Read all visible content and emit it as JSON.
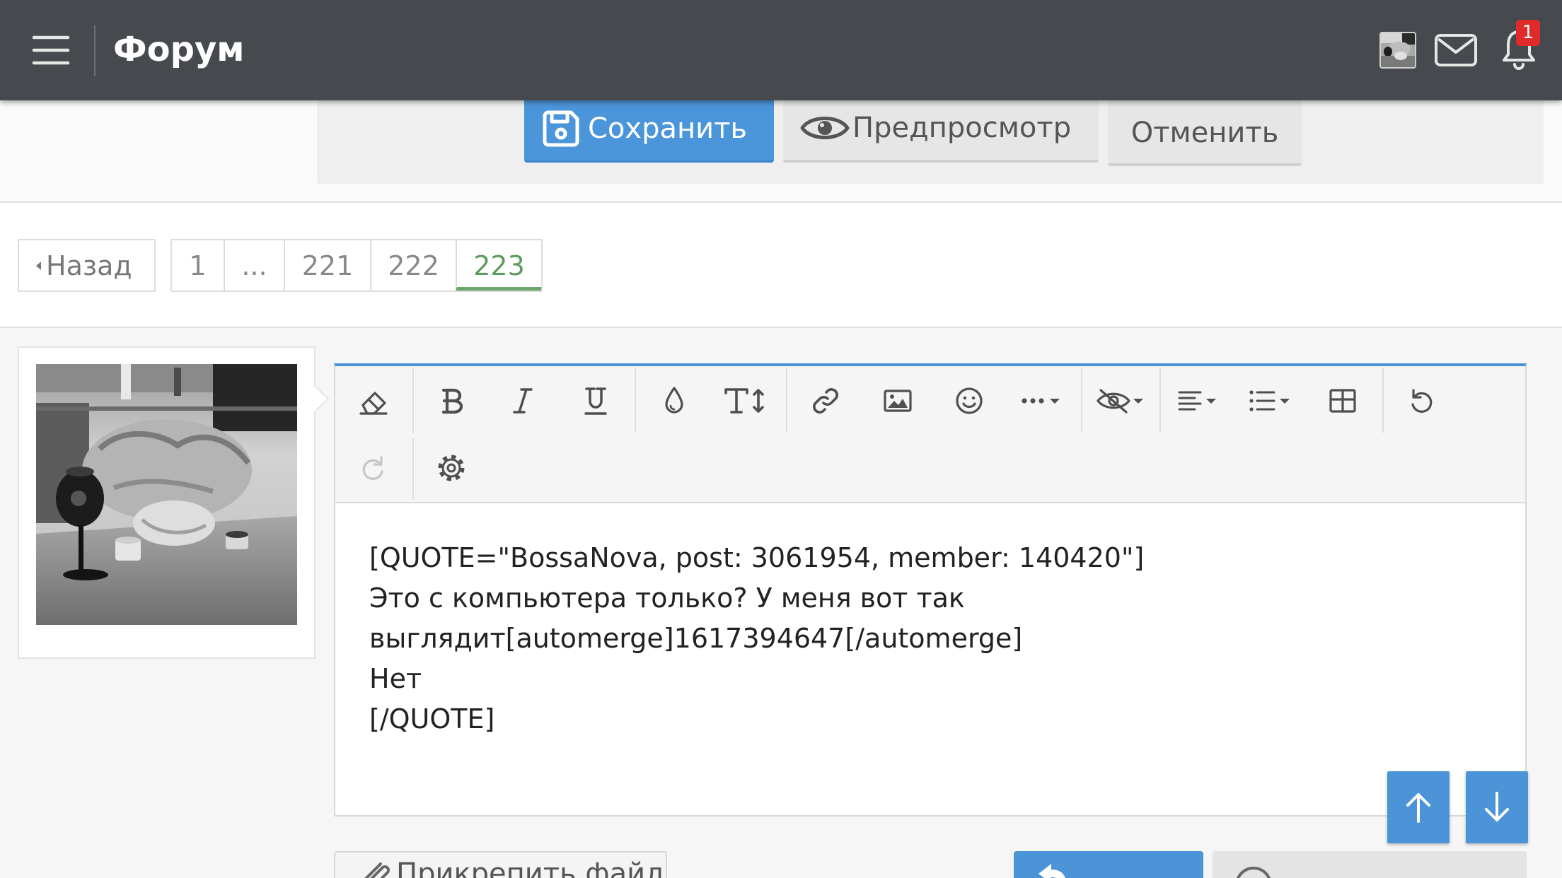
{
  "header": {
    "title": "Форум",
    "notification_count": "1",
    "icons": [
      "menu-icon",
      "user-avatar",
      "mail-icon",
      "bell-icon"
    ]
  },
  "form_actions": {
    "save_label": "Сохранить",
    "preview_label": "Предпросмотр",
    "cancel_label": "Отменить",
    "icons": [
      "floppy-disk-icon",
      "eye-icon"
    ]
  },
  "pagination": {
    "prev_label": "Назад",
    "pages": [
      "1",
      "...",
      "221",
      "222"
    ],
    "current_page": "223"
  },
  "editor": {
    "toolbar_row1": [
      "eraser-icon",
      "bold-icon",
      "italic-icon",
      "underline-icon",
      "droplet-icon",
      "font-size-icon",
      "link-icon",
      "image-icon",
      "smile-icon",
      "more-dots-icon",
      "eye-slash-icon",
      "align-left-icon",
      "list-icon",
      "table-icon",
      "undo-icon"
    ],
    "toolbar_row2": [
      "redo-icon",
      "gear-icon"
    ],
    "content_lines": [
      "[QUOTE=\"BossaNova, post: 3061954, member: 140420\"]",
      "Это с компьютера только? У меня вот так",
      "выглядит[automerge]1617394647[/automerge]",
      "Нет",
      "[/QUOTE]"
    ]
  },
  "scroll_controls": {
    "icons": [
      "arrow-up-icon",
      "arrow-down-icon"
    ]
  },
  "footer_actions": {
    "attach_label": "Прикрепить файлы",
    "icons": [
      "paperclip-icon",
      "reply-icon",
      "circle-icon"
    ]
  },
  "colors": {
    "header_bg": "#46494d",
    "accent_blue": "#4b95da",
    "current_page_green": "#5e9b5e",
    "notification_red": "#e02b2b",
    "text": "#222222"
  }
}
